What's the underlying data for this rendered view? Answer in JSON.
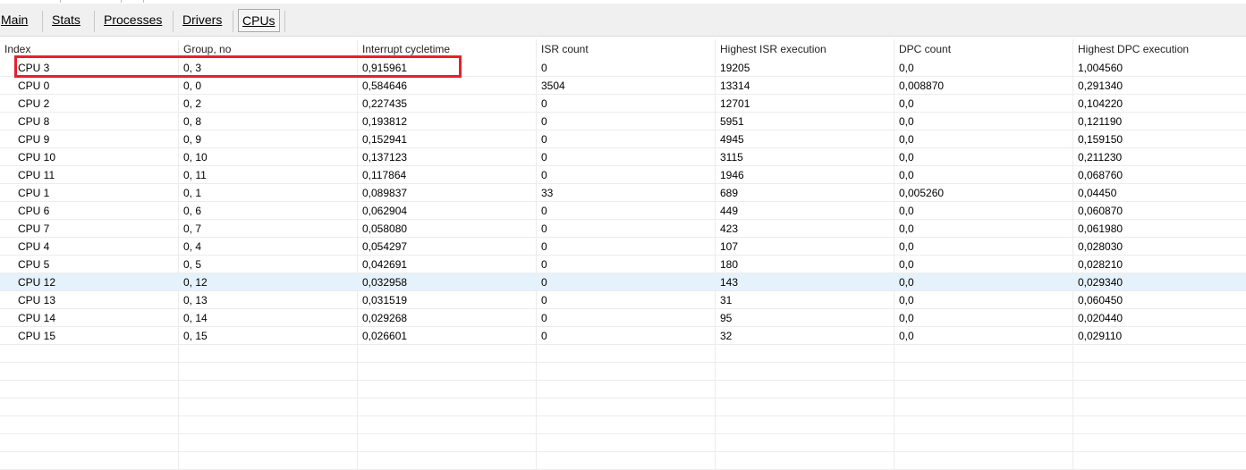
{
  "tabs": [
    {
      "name": "main",
      "label": "Main"
    },
    {
      "name": "stats",
      "label": "Stats"
    },
    {
      "name": "processes",
      "label": "Processes"
    },
    {
      "name": "drivers",
      "label": "Drivers"
    },
    {
      "name": "cpus",
      "label": "CPUs",
      "active": true
    }
  ],
  "columns": [
    "Index",
    "Group, no",
    "Interrupt cycletime",
    "ISR count",
    "Highest ISR execution",
    "DPC count",
    "Highest DPC execution"
  ],
  "rows": [
    [
      "CPU 3",
      "0, 3",
      "0,915961",
      "0",
      "19205",
      "0,0",
      "1,004560"
    ],
    [
      "CPU 0",
      "0, 0",
      "0,584646",
      "3504",
      "13314",
      "0,008870",
      "0,291340"
    ],
    [
      "CPU 2",
      "0, 2",
      "0,227435",
      "0",
      "12701",
      "0,0",
      "0,104220"
    ],
    [
      "CPU 8",
      "0, 8",
      "0,193812",
      "0",
      "5951",
      "0,0",
      "0,121190"
    ],
    [
      "CPU 9",
      "0, 9",
      "0,152941",
      "0",
      "4945",
      "0,0",
      "0,159150"
    ],
    [
      "CPU 10",
      "0, 10",
      "0,137123",
      "0",
      "3115",
      "0,0",
      "0,211230"
    ],
    [
      "CPU 11",
      "0, 11",
      "0,117864",
      "0",
      "1946",
      "0,0",
      "0,068760"
    ],
    [
      "CPU 1",
      "0, 1",
      "0,089837",
      "33",
      "689",
      "0,005260",
      "0,04450"
    ],
    [
      "CPU 6",
      "0, 6",
      "0,062904",
      "0",
      "449",
      "0,0",
      "0,060870"
    ],
    [
      "CPU 7",
      "0, 7",
      "0,058080",
      "0",
      "423",
      "0,0",
      "0,061980"
    ],
    [
      "CPU 4",
      "0, 4",
      "0,054297",
      "0",
      "107",
      "0,0",
      "0,028030"
    ],
    [
      "CPU 5",
      "0, 5",
      "0,042691",
      "0",
      "180",
      "0,0",
      "0,028210"
    ],
    [
      "CPU 12",
      "0, 12",
      "0,032958",
      "0",
      "143",
      "0,0",
      "0,029340"
    ],
    [
      "CPU 13",
      "0, 13",
      "0,031519",
      "0",
      "31",
      "0,0",
      "0,060450"
    ],
    [
      "CPU 14",
      "0, 14",
      "0,029268",
      "0",
      "95",
      "0,0",
      "0,020440"
    ],
    [
      "CPU 15",
      "0, 15",
      "0,026601",
      "0",
      "32",
      "0,0",
      "0,029110"
    ]
  ],
  "selected_row": 12,
  "highlighted_row": 0,
  "colors": {
    "highlight_border": "#e8202b",
    "selected_row_bg": "#e5f1fb"
  }
}
